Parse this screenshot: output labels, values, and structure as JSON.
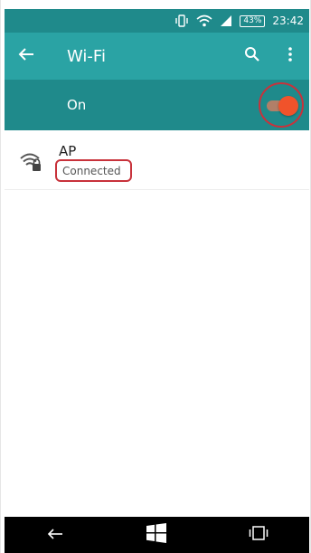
{
  "status_bar": {
    "battery": "43%",
    "time": "23:42",
    "icons": [
      "vibrate-icon",
      "wifi-icon",
      "signal-icon",
      "battery-icon"
    ]
  },
  "app_bar": {
    "title": "Wi-Fi",
    "back_icon": "arrow-left-icon",
    "actions": [
      "search-icon",
      "overflow-menu-icon"
    ]
  },
  "wifi_toggle": {
    "label": "On",
    "state": true
  },
  "networks": [
    {
      "name": "AP",
      "status": "Connected",
      "icon": "wifi-locked-icon"
    }
  ],
  "nav_bar": {
    "buttons": [
      "back-icon",
      "windows-start-icon",
      "task-view-icon"
    ]
  },
  "colors": {
    "status_bar": "#1f8a8b",
    "app_bar": "#2aa3a4",
    "toggle_row": "#1f8a8b",
    "switch_accent": "#f0532b",
    "annotation": "#c8323b"
  }
}
